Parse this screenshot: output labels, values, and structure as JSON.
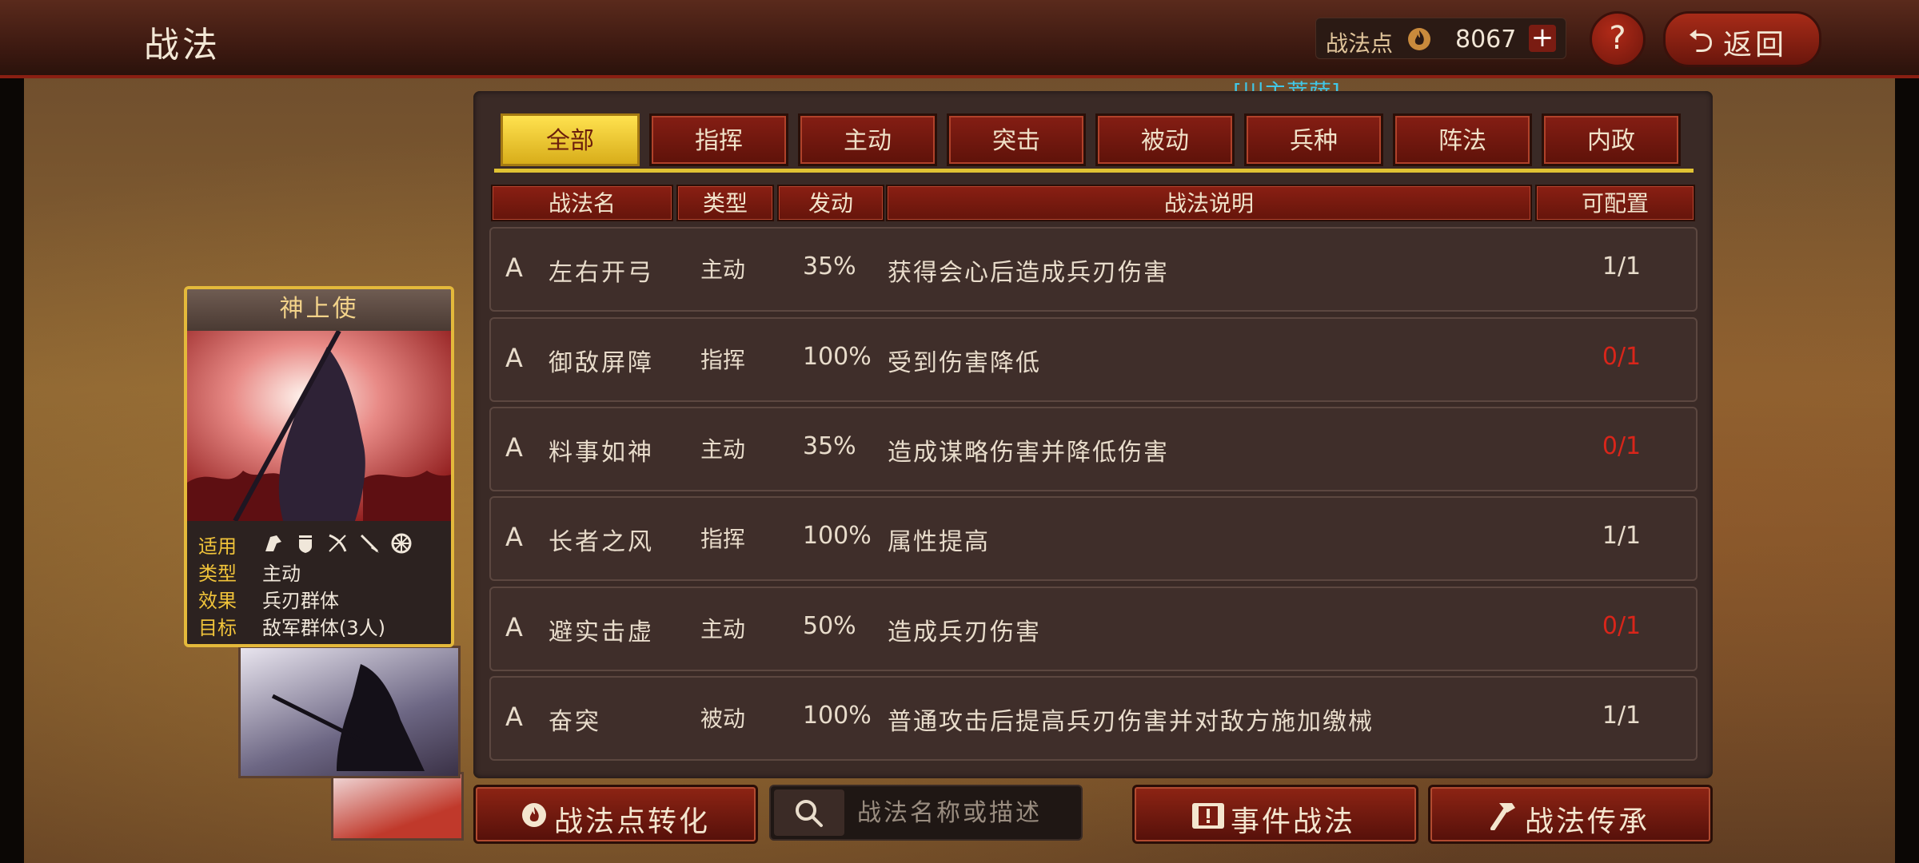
{
  "header": {
    "title": "战法",
    "points_label": "战法点",
    "points_value": "8067",
    "plus": "+",
    "help": "?",
    "back_label": "返回"
  },
  "general_tag": "[川主菩萨]",
  "tabs": [
    {
      "label": "全部",
      "active": true
    },
    {
      "label": "指挥"
    },
    {
      "label": "主动"
    },
    {
      "label": "突击"
    },
    {
      "label": "被动"
    },
    {
      "label": "兵种"
    },
    {
      "label": "阵法"
    },
    {
      "label": "内政"
    }
  ],
  "columns": [
    "战法名",
    "类型",
    "发动",
    "战法说明",
    "可配置"
  ],
  "rows": [
    {
      "grade": "A",
      "name": "左右开弓",
      "type": "主动",
      "rate": "35%",
      "desc": "获得会心后造成兵刃伤害",
      "slot": "1/1",
      "slot_color": "#e8dccb"
    },
    {
      "grade": "A",
      "name": "御敌屏障",
      "type": "指挥",
      "rate": "100%",
      "desc": "受到伤害降低",
      "slot": "0/1",
      "slot_color": "#d8251a"
    },
    {
      "grade": "A",
      "name": "料事如神",
      "type": "主动",
      "rate": "35%",
      "desc": "造成谋略伤害并降低伤害",
      "slot": "0/1",
      "slot_color": "#d8251a"
    },
    {
      "grade": "A",
      "name": "长者之风",
      "type": "指挥",
      "rate": "100%",
      "desc": "属性提高",
      "slot": "1/1",
      "slot_color": "#e8dccb"
    },
    {
      "grade": "A",
      "name": "避实击虚",
      "type": "主动",
      "rate": "50%",
      "desc": "造成兵刃伤害",
      "slot": "0/1",
      "slot_color": "#d8251a"
    },
    {
      "grade": "A",
      "name": "奋突",
      "type": "被动",
      "rate": "100%",
      "desc": "普通攻击后提高兵刃伤害并对敌方施加缴械",
      "slot": "1/1",
      "slot_color": "#e8dccb"
    }
  ],
  "card": {
    "title": "神上使",
    "apply_label": "适用",
    "type_label": "类型",
    "type_value": "主动",
    "effect_label": "效果",
    "effect_value": "兵刃群体",
    "target_label": "目标",
    "target_value": "敌军群体(3人)",
    "unit_icons": [
      "cavalry-icon",
      "shield-icon",
      "bow-icon",
      "spear-icon",
      "wheel-icon"
    ]
  },
  "bottom": {
    "convert_label": "战法点转化",
    "search_placeholder": "战法名称或描述",
    "event_label": "事件战法",
    "inherit_label": "战法传承"
  },
  "colors": {
    "accent_gold": "#e0c233",
    "button_red": "#851e14",
    "zero_red": "#d8251a",
    "general_cyan": "#41c7e6"
  }
}
